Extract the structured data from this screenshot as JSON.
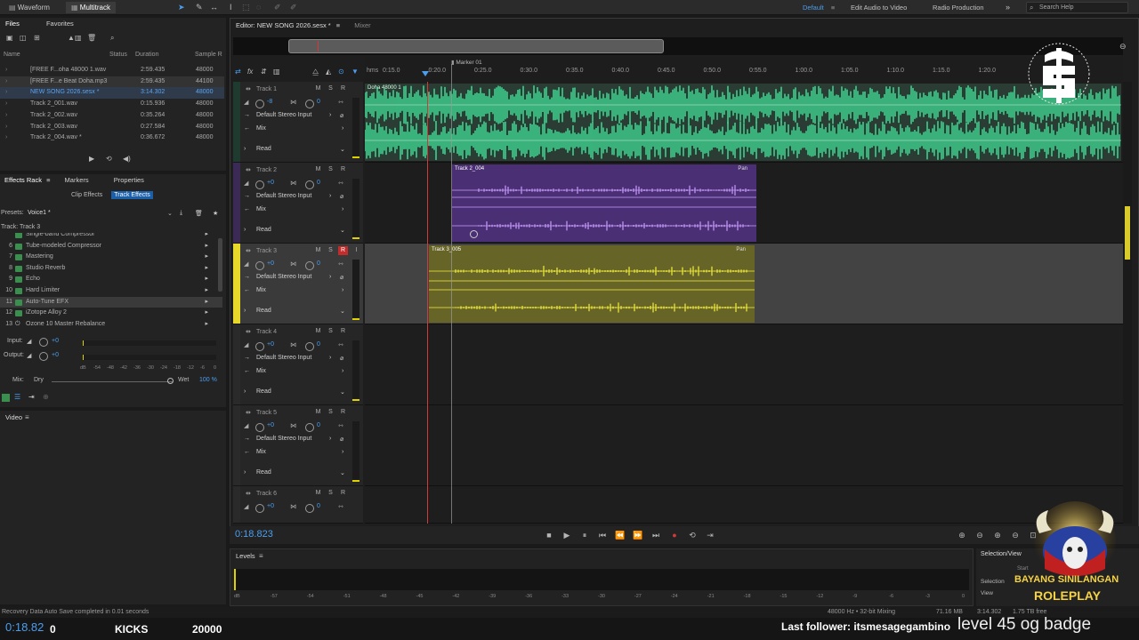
{
  "top_bar": {
    "waveform_tab": "Waveform",
    "multitrack_tab": "Multitrack",
    "workspaces": [
      "Default",
      "Edit Audio to Video",
      "Radio Production"
    ],
    "search_placeholder": "Search Help"
  },
  "files_panel": {
    "tabs": [
      "Files",
      "Favorites"
    ],
    "columns": [
      "Name",
      "Status",
      "Duration",
      "Sample R"
    ],
    "rows": [
      {
        "name": "[FREE F...oha 48000 1.wav",
        "duration": "2:59.435",
        "rate": "48000"
      },
      {
        "name": "[FREE F...e Beat Doha.mp3",
        "duration": "2:59.435",
        "rate": "44100"
      },
      {
        "name": "NEW SONG 2026.sesx *",
        "duration": "3:14.302",
        "rate": "48000"
      },
      {
        "name": "Track 2_001.wav",
        "duration": "0:15.936",
        "rate": "48000"
      },
      {
        "name": "Track 2_002.wav",
        "duration": "0:35.264",
        "rate": "48000"
      },
      {
        "name": "Track 2_003.wav",
        "duration": "0:27.584",
        "rate": "48000"
      },
      {
        "name": "Track 2_004.wav *",
        "duration": "0:36.672",
        "rate": "48000"
      }
    ]
  },
  "effects_rack": {
    "tabs": [
      "Effects Rack",
      "Markers",
      "Properties"
    ],
    "subtabs": [
      "Clip Effects",
      "Track Effects"
    ],
    "presets_label": "Presets:",
    "preset_value": "Voice1 *",
    "track_label": "Track: Track 3",
    "effects": [
      {
        "n": "",
        "name": "Single-band Compressor"
      },
      {
        "n": "6",
        "name": "Tube-modeled Compressor"
      },
      {
        "n": "7",
        "name": "Mastering"
      },
      {
        "n": "8",
        "name": "Studio Reverb"
      },
      {
        "n": "9",
        "name": "Echo"
      },
      {
        "n": "10",
        "name": "Hard Limiter"
      },
      {
        "n": "11",
        "name": "Auto-Tune EFX"
      },
      {
        "n": "12",
        "name": "iZotope Alloy 2"
      },
      {
        "n": "13",
        "name": "Ozone 10 Master Rebalance"
      }
    ],
    "input_label": "Input:",
    "input_value": "+0",
    "output_label": "Output:",
    "output_value": "+0",
    "meter_ticks": [
      "dB",
      "-54",
      "-48",
      "-42",
      "-36",
      "-30",
      "-24",
      "-18",
      "-12",
      "-6",
      "0"
    ],
    "mix_label": "Mix:",
    "dry_label": "Dry",
    "wet_label": "Wet",
    "wet_value": "100 %",
    "video_label": "Video"
  },
  "editor": {
    "tab_label": "Editor: NEW SONG 2026.sesx *",
    "mixer_tab": "Mixer",
    "marker_label": "Marker 01",
    "ruler_ticks": [
      "hms",
      "0:15.0",
      "0:20.0",
      "0:25.0",
      "0:30.0",
      "0:35.0",
      "0:40.0",
      "0:45.0",
      "0:50.0",
      "0:55.0",
      "1:00.0",
      "1:05.0",
      "1:10.0",
      "1:15.0",
      "1:20.0"
    ],
    "input_label": "Default Stereo Input",
    "mix_label": "Mix",
    "read_label": "Read",
    "tracks": [
      {
        "name": "Track 1",
        "vol": "-8",
        "pan": "0",
        "clip": "Doha 48000 1",
        "color": "#3fcf8e"
      },
      {
        "name": "Track 2",
        "vol": "+0",
        "pan": "0",
        "clip": "Track 2_004",
        "color": "#8a4ed0"
      },
      {
        "name": "Track 3",
        "vol": "+0",
        "pan": "0",
        "clip": "Track 3_005",
        "color": "#c9c62a"
      },
      {
        "name": "Track 4",
        "vol": "+0",
        "pan": "0",
        "clip": "",
        "color": "#4a6fd0"
      },
      {
        "name": "Track 5",
        "vol": "+0",
        "pan": "0",
        "clip": "",
        "color": "#b04ac0"
      },
      {
        "name": "Track 6",
        "vol": "+0",
        "pan": "0",
        "clip": "",
        "color": "#4ab06a"
      }
    ],
    "clip_pan_label": "Pan"
  },
  "transport": {
    "time": "0:18.823"
  },
  "levels": {
    "title": "Levels",
    "ticks": [
      "dB",
      "-57",
      "-54",
      "-51",
      "-48",
      "-45",
      "-42",
      "-39",
      "-36",
      "-33",
      "-30",
      "-27",
      "-24",
      "-21",
      "-18",
      "-15",
      "-12",
      "-9",
      "-6",
      "-3",
      "0"
    ]
  },
  "selection_view": {
    "title": "Selection/View",
    "selection_label": "Selection",
    "view_label": "View",
    "start_label": "Start"
  },
  "status_bar": {
    "message": "Recovery Data Auto Save completed in 0.01 seconds",
    "format": "48000 Hz • 32-bit Mixing",
    "memory": "71.16 MB",
    "duration": "3:14.302",
    "free": "1.75 TB free"
  },
  "stream_overlay": {
    "time": "0:18.82",
    "counter": "0",
    "kicks_label": "KICKS",
    "kicks_value": "20000",
    "follower": "Last follower: itsmesagegambino",
    "ticker": "level 45 og badge",
    "brand_line1": "BAYANG SINILANGAN",
    "brand_line2": "ROLEPLAY"
  },
  "colors": {
    "accent": "#4b9eee",
    "track1": "#3fcf8e",
    "track2": "#8a4ed0",
    "track3": "#c9c62a",
    "playhead": "#d23a3a"
  }
}
